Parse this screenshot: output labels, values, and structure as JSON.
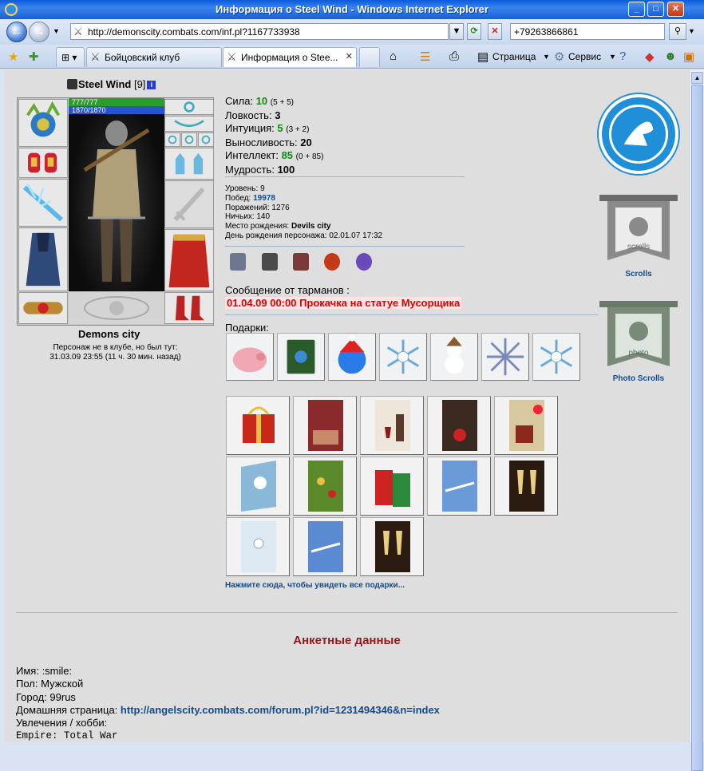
{
  "window": {
    "title": "Информация о Steel Wind - Windows Internet Explorer"
  },
  "browser": {
    "address": "http://demonscity.combats.com/inf.pl?1167733938",
    "search_value": "+79263866861",
    "tabs": [
      {
        "label": "Бойцовский клуб"
      },
      {
        "label": "Информация о Stee..."
      }
    ],
    "toolbar": {
      "page_label": "Страница",
      "tools_label": "Сервис"
    }
  },
  "character": {
    "name": "Steel Wind",
    "level": "[9]",
    "hp": "777/777",
    "mana": "1870/1870",
    "city": "Demons city",
    "club_note": "Персонаж не в клубе, но был тут:",
    "last_seen": "31.03.09 23:55 (11 ч. 30 мин. назад)"
  },
  "stats": [
    {
      "label": "Сила:",
      "value": "10",
      "extra": "(5 + 5)",
      "highlight": true
    },
    {
      "label": "Ловкость:",
      "value": "3",
      "extra": "",
      "highlight": false
    },
    {
      "label": "Интуиция:",
      "value": "5",
      "extra": "(3 + 2)",
      "highlight": true
    },
    {
      "label": "Выносливость:",
      "value": "20",
      "extra": "",
      "highlight": false
    },
    {
      "label": "Интеллект:",
      "value": "85",
      "extra": "(0 + 85)",
      "highlight": true
    },
    {
      "label": "Мудрость:",
      "value": "100",
      "extra": "",
      "highlight": false
    }
  ],
  "details": {
    "level_label": "Уровень:",
    "level_value": "9",
    "wins_label": "Побед:",
    "wins_value": "19978",
    "losses_label": "Поражений:",
    "losses_value": "1276",
    "draws_label": "Ничьих:",
    "draws_value": "140",
    "birthplace_label": "Место рождения:",
    "birthplace_value": "Devils city",
    "birthday_label": "День рождения персонажа:",
    "birthday_value": "02.01.07 17:32"
  },
  "message": {
    "heading": "Сообщение от тарманов :",
    "text": "01.04.09 00:00 Прокачка на статуе Мусорщика"
  },
  "gifts": {
    "label": "Подарки:",
    "see_all": "Нажмите сюда, чтобы увидеть все подарки..."
  },
  "sidebar": {
    "scrolls_label": "Scrolls",
    "photo_scrolls_label": "Photo Scrolls",
    "scrolls_banner_text": "scrolls",
    "photo_banner_text": "photo"
  },
  "profile": {
    "heading": "Анкетные данные",
    "name_label": "Имя:",
    "name_value": ":smile:",
    "sex_label": "Пол:",
    "sex_value": "Мужской",
    "city_label": "Город:",
    "city_value": "99rus",
    "homepage_label": "Домашняя страница:",
    "homepage_value": "http://angelscity.combats.com/forum.pl?id=1231494346&n=index",
    "hobby_label": "Увлечения / хобби:",
    "hobby_value": "Empire: Total War"
  },
  "colors": {
    "accent": "#114b8e",
    "alert": "#e00000",
    "stat_green": "#0f8a0f",
    "heading": "#8b1a1a"
  }
}
